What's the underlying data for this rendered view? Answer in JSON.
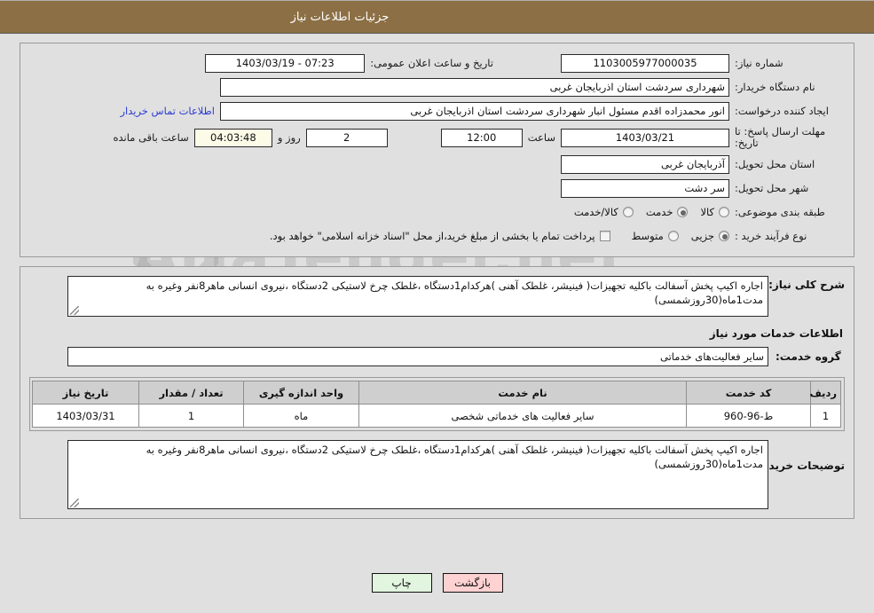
{
  "header": {
    "title": "جزئیات اطلاعات نیاز"
  },
  "watermark": {
    "text": "AriaTender.net"
  },
  "fields": {
    "need_number_label": "شماره نیاز:",
    "need_number_value": "1103005977000035",
    "announce_label": "تاریخ و ساعت اعلان عمومی:",
    "announce_value": "07:23 - 1403/03/19",
    "buyer_org_label": "نام دستگاه خریدار:",
    "buyer_org_value": "شهرداری سردشت استان اذربایجان غربی",
    "creator_label": "ایجاد کننده درخواست:",
    "creator_value": "انور محمدزاده اقدم مسئول انبار شهرداری سردشت استان اذربایجان غربی",
    "contact_link": "اطلاعات تماس خریدار",
    "deadline_label": "مهلت ارسال پاسخ: تا تاریخ:",
    "deadline_date": "1403/03/21",
    "deadline_hour_label": "ساعت",
    "deadline_hour_value": "12:00",
    "days_value": "2",
    "days_label": "روز و",
    "remaining_value": "04:03:48",
    "remaining_label": "ساعت باقی مانده",
    "province_label": "استان محل تحویل:",
    "province_value": "آذربایجان غربی",
    "city_label": "شهر محل تحویل:",
    "city_value": "سر دشت",
    "category_label": "طبقه بندی موضوعی:",
    "process_label": "نوع فرآیند خرید :",
    "treasury_note": "پرداخت تمام یا بخشی از مبلغ خرید،از محل \"اسناد خزانه اسلامی\" خواهد بود."
  },
  "category_options": [
    {
      "label": "کالا",
      "checked": false
    },
    {
      "label": "خدمت",
      "checked": true
    },
    {
      "label": "کالا/خدمت",
      "checked": false
    }
  ],
  "process_options": [
    {
      "label": "جزیی",
      "checked": true
    },
    {
      "label": "متوسط",
      "checked": false
    }
  ],
  "description": {
    "label": "شرح کلی نیاز:",
    "value": "اجاره اکیپ پخش آسفالت باکلیه تجهیزات( فینیشر، غلطک آهنی )هرکدام1دستگاه ،غلطک چرخ لاستیکی 2دستگاه ،نیروی انسانی ماهر8نفر وغیره به مدت1ماه(30روزشمسی)"
  },
  "services_section": {
    "heading": "اطلاعات خدمات مورد نیاز",
    "group_label": "گروه خدمت:",
    "group_value": "سایر فعالیت‌های خدماتی"
  },
  "table": {
    "columns": [
      "ردیف",
      "کد خدمت",
      "نام خدمت",
      "واحد اندازه گیری",
      "تعداد / مقدار",
      "تاریخ نیاز"
    ],
    "rows": [
      {
        "row_no": "1",
        "service_code": "ط-96-960",
        "service_name": "سایر فعالیت های خدماتی شخصی",
        "unit": "ماه",
        "quantity": "1",
        "need_date": "1403/03/31"
      }
    ]
  },
  "buyer_notes": {
    "label": "توضیحات خریدار:",
    "value": "اجاره اکیپ پخش آسفالت باکلیه تجهیزات( فینیشر، غلطک آهنی )هرکدام1دستگاه ،غلطک چرخ لاستیکی 2دستگاه ،نیروی انسانی ماهر8نفر وغیره به مدت1ماه(30روزشمسی)"
  },
  "footer": {
    "back_label": "بازگشت",
    "print_label": "چاپ"
  }
}
